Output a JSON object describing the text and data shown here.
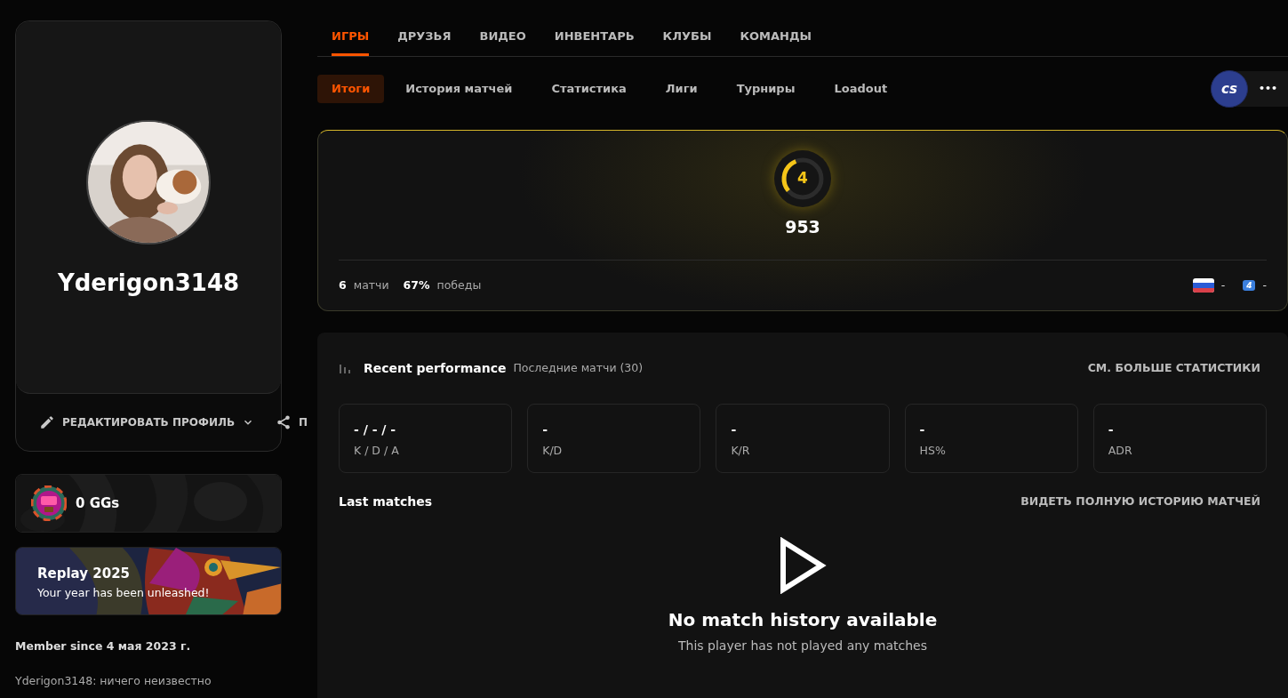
{
  "profile": {
    "username": "Yderigon3148",
    "edit_button": "РЕДАКТИРОВАТЬ ПРОФИЛЬ",
    "share_button": "П"
  },
  "gg_card": {
    "label": "0 GGs"
  },
  "replay_card": {
    "title": "Replay 2025",
    "subtitle": "Your year has been unleashed!"
  },
  "member_since": "Member since 4 мая 2023 г.",
  "bio": "Yderigon3148: ничего неизвестно",
  "tabs": [
    {
      "label": "ИГРЫ",
      "selected": true
    },
    {
      "label": "ДРУЗЬЯ",
      "selected": false
    },
    {
      "label": "ВИДЕО",
      "selected": false
    },
    {
      "label": "ИНВЕНТАРЬ",
      "selected": false
    },
    {
      "label": "КЛУБЫ",
      "selected": false
    },
    {
      "label": "КОМАНДЫ",
      "selected": false
    }
  ],
  "subtabs": [
    {
      "label": "Итоги",
      "selected": true
    },
    {
      "label": "История матчей",
      "selected": false
    },
    {
      "label": "Статистика",
      "selected": false
    },
    {
      "label": "Лиги",
      "selected": false
    },
    {
      "label": "Турниры",
      "selected": false
    },
    {
      "label": "Loadout",
      "selected": false
    }
  ],
  "game_badge": {
    "label": "cs"
  },
  "more_button": "•••",
  "rating": {
    "skill_level": "4",
    "level": 0.3,
    "elo": "953",
    "matches": "6",
    "matches_label": "матчи",
    "winrate": "67%",
    "winrate_label": "победы",
    "country_rank": "-",
    "region_badge": "4",
    "region_rank": "-"
  },
  "performance": {
    "title": "Recent performance",
    "subtitle": "Последние матчи (30)",
    "more_link": "СМ. БОЛЬШЕ СТАТИСТИКИ",
    "stats": [
      {
        "value": "- / - / -",
        "label": "K / D / A"
      },
      {
        "value": "-",
        "label": "K/D"
      },
      {
        "value": "-",
        "label": "K/R"
      },
      {
        "value": "-",
        "label": "HS%"
      },
      {
        "value": "-",
        "label": "ADR"
      }
    ]
  },
  "last_matches": {
    "title": "Last matches",
    "history_link": "ВИДЕТЬ ПОЛНУЮ ИСТОРИЮ МАТЧЕЙ",
    "empty_title": "No match history available",
    "empty_text": "This player has not played any matches"
  }
}
